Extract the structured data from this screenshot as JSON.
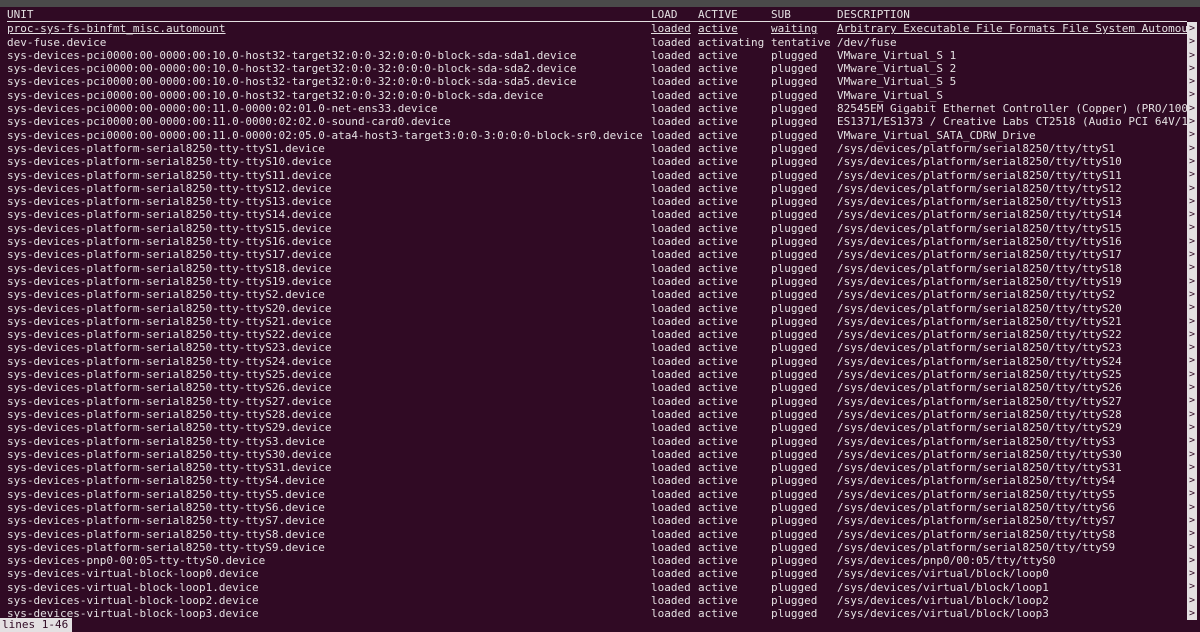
{
  "header": {
    "unit": "UNIT",
    "load": "LOAD",
    "active": "ACTIVE",
    "sub": "SUB",
    "description": "DESCRIPTION"
  },
  "rows": [
    {
      "unit": "proc-sys-fs-binfmt_misc.automount",
      "load": "loaded",
      "active": "active",
      "sub": "waiting",
      "desc": "Arbitrary Executable File Formats File System Automou"
    },
    {
      "unit": "dev-fuse.device",
      "load": "loaded",
      "active": "activating",
      "sub": "tentative",
      "desc": "/dev/fuse"
    },
    {
      "unit": "sys-devices-pci0000:00-0000:00:10.0-host32-target32:0:0-32:0:0:0-block-sda-sda1.device",
      "load": "loaded",
      "active": "active",
      "sub": "plugged",
      "desc": "VMware_Virtual_S 1"
    },
    {
      "unit": "sys-devices-pci0000:00-0000:00:10.0-host32-target32:0:0-32:0:0:0-block-sda-sda2.device",
      "load": "loaded",
      "active": "active",
      "sub": "plugged",
      "desc": "VMware_Virtual_S 2"
    },
    {
      "unit": "sys-devices-pci0000:00-0000:00:10.0-host32-target32:0:0-32:0:0:0-block-sda-sda5.device",
      "load": "loaded",
      "active": "active",
      "sub": "plugged",
      "desc": "VMware_Virtual_S 5"
    },
    {
      "unit": "sys-devices-pci0000:00-0000:00:10.0-host32-target32:0:0-32:0:0:0-block-sda.device",
      "load": "loaded",
      "active": "active",
      "sub": "plugged",
      "desc": "VMware_Virtual_S"
    },
    {
      "unit": "sys-devices-pci0000:00-0000:00:11.0-0000:02:01.0-net-ens33.device",
      "load": "loaded",
      "active": "active",
      "sub": "plugged",
      "desc": "82545EM Gigabit Ethernet Controller (Copper) (PRO/100"
    },
    {
      "unit": "sys-devices-pci0000:00-0000:00:11.0-0000:02:02.0-sound-card0.device",
      "load": "loaded",
      "active": "active",
      "sub": "plugged",
      "desc": "ES1371/ES1373 / Creative Labs CT2518 (Audio PCI 64V/1"
    },
    {
      "unit": "sys-devices-pci0000:00-0000:00:11.0-0000:02:05.0-ata4-host3-target3:0:0-3:0:0:0-block-sr0.device",
      "load": "loaded",
      "active": "active",
      "sub": "plugged",
      "desc": "VMware_Virtual_SATA_CDRW_Drive"
    },
    {
      "unit": "sys-devices-platform-serial8250-tty-ttyS1.device",
      "load": "loaded",
      "active": "active",
      "sub": "plugged",
      "desc": "/sys/devices/platform/serial8250/tty/ttyS1"
    },
    {
      "unit": "sys-devices-platform-serial8250-tty-ttyS10.device",
      "load": "loaded",
      "active": "active",
      "sub": "plugged",
      "desc": "/sys/devices/platform/serial8250/tty/ttyS10"
    },
    {
      "unit": "sys-devices-platform-serial8250-tty-ttyS11.device",
      "load": "loaded",
      "active": "active",
      "sub": "plugged",
      "desc": "/sys/devices/platform/serial8250/tty/ttyS11"
    },
    {
      "unit": "sys-devices-platform-serial8250-tty-ttyS12.device",
      "load": "loaded",
      "active": "active",
      "sub": "plugged",
      "desc": "/sys/devices/platform/serial8250/tty/ttyS12"
    },
    {
      "unit": "sys-devices-platform-serial8250-tty-ttyS13.device",
      "load": "loaded",
      "active": "active",
      "sub": "plugged",
      "desc": "/sys/devices/platform/serial8250/tty/ttyS13"
    },
    {
      "unit": "sys-devices-platform-serial8250-tty-ttyS14.device",
      "load": "loaded",
      "active": "active",
      "sub": "plugged",
      "desc": "/sys/devices/platform/serial8250/tty/ttyS14"
    },
    {
      "unit": "sys-devices-platform-serial8250-tty-ttyS15.device",
      "load": "loaded",
      "active": "active",
      "sub": "plugged",
      "desc": "/sys/devices/platform/serial8250/tty/ttyS15"
    },
    {
      "unit": "sys-devices-platform-serial8250-tty-ttyS16.device",
      "load": "loaded",
      "active": "active",
      "sub": "plugged",
      "desc": "/sys/devices/platform/serial8250/tty/ttyS16"
    },
    {
      "unit": "sys-devices-platform-serial8250-tty-ttyS17.device",
      "load": "loaded",
      "active": "active",
      "sub": "plugged",
      "desc": "/sys/devices/platform/serial8250/tty/ttyS17"
    },
    {
      "unit": "sys-devices-platform-serial8250-tty-ttyS18.device",
      "load": "loaded",
      "active": "active",
      "sub": "plugged",
      "desc": "/sys/devices/platform/serial8250/tty/ttyS18"
    },
    {
      "unit": "sys-devices-platform-serial8250-tty-ttyS19.device",
      "load": "loaded",
      "active": "active",
      "sub": "plugged",
      "desc": "/sys/devices/platform/serial8250/tty/ttyS19"
    },
    {
      "unit": "sys-devices-platform-serial8250-tty-ttyS2.device",
      "load": "loaded",
      "active": "active",
      "sub": "plugged",
      "desc": "/sys/devices/platform/serial8250/tty/ttyS2"
    },
    {
      "unit": "sys-devices-platform-serial8250-tty-ttyS20.device",
      "load": "loaded",
      "active": "active",
      "sub": "plugged",
      "desc": "/sys/devices/platform/serial8250/tty/ttyS20"
    },
    {
      "unit": "sys-devices-platform-serial8250-tty-ttyS21.device",
      "load": "loaded",
      "active": "active",
      "sub": "plugged",
      "desc": "/sys/devices/platform/serial8250/tty/ttyS21"
    },
    {
      "unit": "sys-devices-platform-serial8250-tty-ttyS22.device",
      "load": "loaded",
      "active": "active",
      "sub": "plugged",
      "desc": "/sys/devices/platform/serial8250/tty/ttyS22"
    },
    {
      "unit": "sys-devices-platform-serial8250-tty-ttyS23.device",
      "load": "loaded",
      "active": "active",
      "sub": "plugged",
      "desc": "/sys/devices/platform/serial8250/tty/ttyS23"
    },
    {
      "unit": "sys-devices-platform-serial8250-tty-ttyS24.device",
      "load": "loaded",
      "active": "active",
      "sub": "plugged",
      "desc": "/sys/devices/platform/serial8250/tty/ttyS24"
    },
    {
      "unit": "sys-devices-platform-serial8250-tty-ttyS25.device",
      "load": "loaded",
      "active": "active",
      "sub": "plugged",
      "desc": "/sys/devices/platform/serial8250/tty/ttyS25"
    },
    {
      "unit": "sys-devices-platform-serial8250-tty-ttyS26.device",
      "load": "loaded",
      "active": "active",
      "sub": "plugged",
      "desc": "/sys/devices/platform/serial8250/tty/ttyS26"
    },
    {
      "unit": "sys-devices-platform-serial8250-tty-ttyS27.device",
      "load": "loaded",
      "active": "active",
      "sub": "plugged",
      "desc": "/sys/devices/platform/serial8250/tty/ttyS27"
    },
    {
      "unit": "sys-devices-platform-serial8250-tty-ttyS28.device",
      "load": "loaded",
      "active": "active",
      "sub": "plugged",
      "desc": "/sys/devices/platform/serial8250/tty/ttyS28"
    },
    {
      "unit": "sys-devices-platform-serial8250-tty-ttyS29.device",
      "load": "loaded",
      "active": "active",
      "sub": "plugged",
      "desc": "/sys/devices/platform/serial8250/tty/ttyS29"
    },
    {
      "unit": "sys-devices-platform-serial8250-tty-ttyS3.device",
      "load": "loaded",
      "active": "active",
      "sub": "plugged",
      "desc": "/sys/devices/platform/serial8250/tty/ttyS3"
    },
    {
      "unit": "sys-devices-platform-serial8250-tty-ttyS30.device",
      "load": "loaded",
      "active": "active",
      "sub": "plugged",
      "desc": "/sys/devices/platform/serial8250/tty/ttyS30"
    },
    {
      "unit": "sys-devices-platform-serial8250-tty-ttyS31.device",
      "load": "loaded",
      "active": "active",
      "sub": "plugged",
      "desc": "/sys/devices/platform/serial8250/tty/ttyS31"
    },
    {
      "unit": "sys-devices-platform-serial8250-tty-ttyS4.device",
      "load": "loaded",
      "active": "active",
      "sub": "plugged",
      "desc": "/sys/devices/platform/serial8250/tty/ttyS4"
    },
    {
      "unit": "sys-devices-platform-serial8250-tty-ttyS5.device",
      "load": "loaded",
      "active": "active",
      "sub": "plugged",
      "desc": "/sys/devices/platform/serial8250/tty/ttyS5"
    },
    {
      "unit": "sys-devices-platform-serial8250-tty-ttyS6.device",
      "load": "loaded",
      "active": "active",
      "sub": "plugged",
      "desc": "/sys/devices/platform/serial8250/tty/ttyS6"
    },
    {
      "unit": "sys-devices-platform-serial8250-tty-ttyS7.device",
      "load": "loaded",
      "active": "active",
      "sub": "plugged",
      "desc": "/sys/devices/platform/serial8250/tty/ttyS7"
    },
    {
      "unit": "sys-devices-platform-serial8250-tty-ttyS8.device",
      "load": "loaded",
      "active": "active",
      "sub": "plugged",
      "desc": "/sys/devices/platform/serial8250/tty/ttyS8"
    },
    {
      "unit": "sys-devices-platform-serial8250-tty-ttyS9.device",
      "load": "loaded",
      "active": "active",
      "sub": "plugged",
      "desc": "/sys/devices/platform/serial8250/tty/ttyS9"
    },
    {
      "unit": "sys-devices-pnp0-00:05-tty-ttyS0.device",
      "load": "loaded",
      "active": "active",
      "sub": "plugged",
      "desc": "/sys/devices/pnp0/00:05/tty/ttyS0"
    },
    {
      "unit": "sys-devices-virtual-block-loop0.device",
      "load": "loaded",
      "active": "active",
      "sub": "plugged",
      "desc": "/sys/devices/virtual/block/loop0"
    },
    {
      "unit": "sys-devices-virtual-block-loop1.device",
      "load": "loaded",
      "active": "active",
      "sub": "plugged",
      "desc": "/sys/devices/virtual/block/loop1"
    },
    {
      "unit": "sys-devices-virtual-block-loop2.device",
      "load": "loaded",
      "active": "active",
      "sub": "plugged",
      "desc": "/sys/devices/virtual/block/loop2"
    },
    {
      "unit": "sys-devices-virtual-block-loop3.device",
      "load": "loaded",
      "active": "active",
      "sub": "plugged",
      "desc": "/sys/devices/virtual/block/loop3"
    }
  ],
  "overflow_marker": ">",
  "status": "lines 1-46",
  "colors": {
    "background": "#300a24",
    "foreground": "#e4e0e2"
  }
}
